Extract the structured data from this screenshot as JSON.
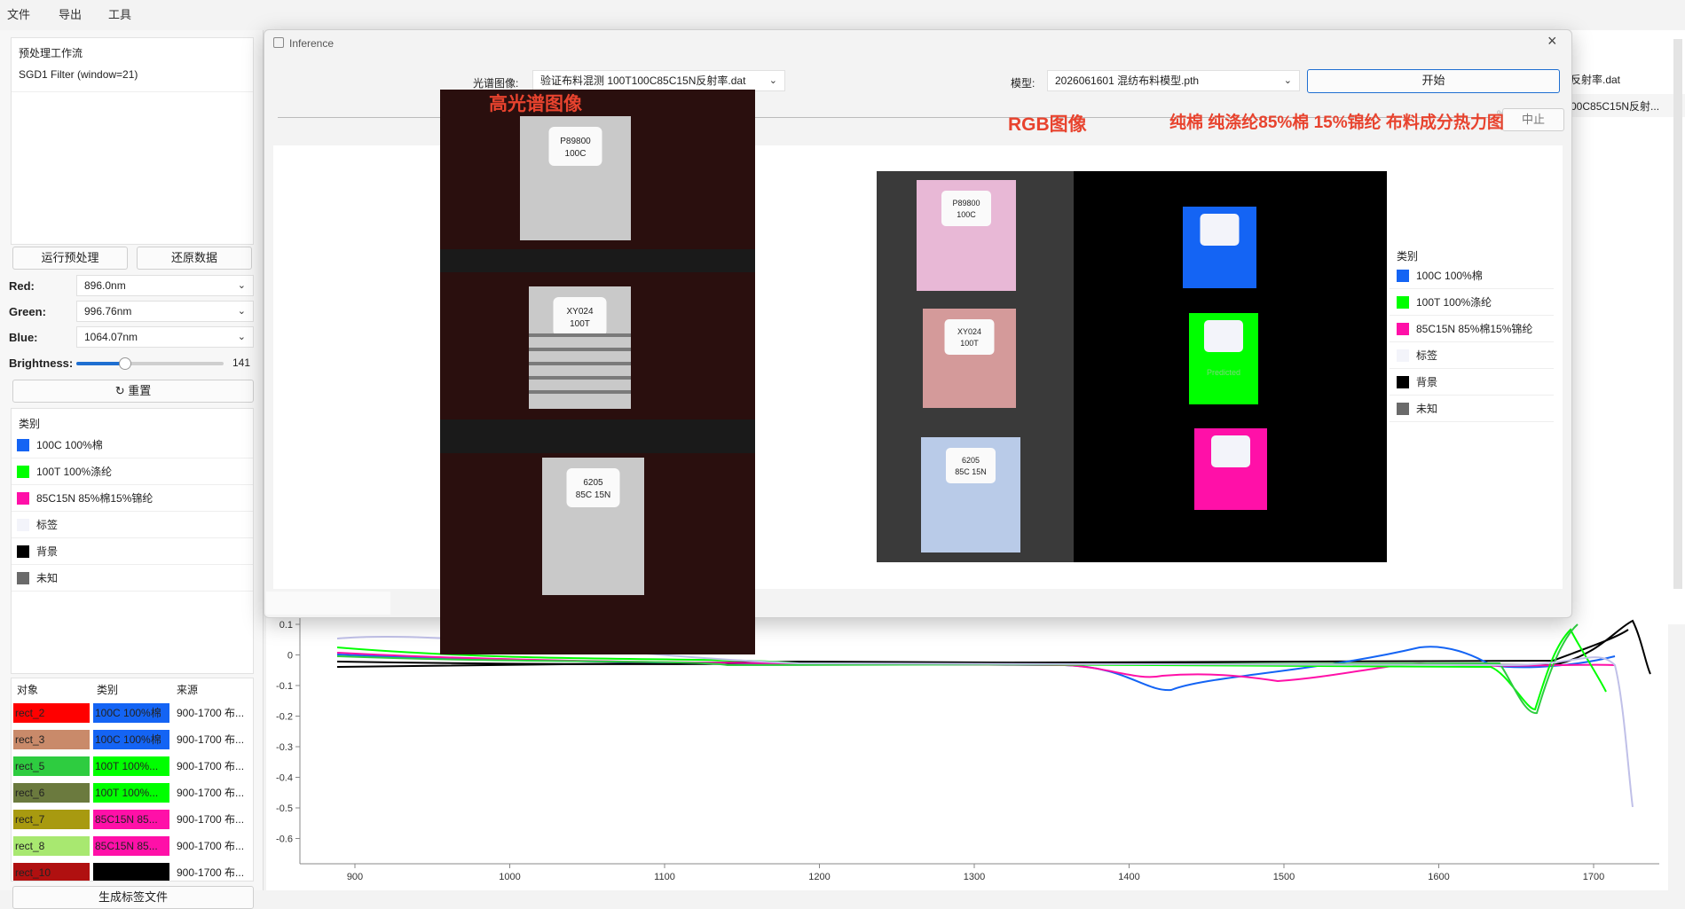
{
  "menu": [
    "文件",
    "导出",
    "工具"
  ],
  "left": {
    "workflow_title": "预处理工作流",
    "workflow_item": "SGD1 Filter (window=21)",
    "run_btn": "运行预处理",
    "restore_btn": "还原数据",
    "red_label": "Red:",
    "red_value": "896.0nm",
    "green_label": "Green:",
    "green_value": "996.76nm",
    "blue_label": "Blue:",
    "blue_value": "1064.07nm",
    "brightness_label": "Brightness:",
    "brightness_value": "141",
    "brightness_level": 0.33,
    "reset_btn": "重置",
    "class_header": "类别",
    "classes": [
      {
        "name": "100C 100%棉",
        "color": "#1464f4"
      },
      {
        "name": "100T 100%涤纶",
        "color": "#00ff00"
      },
      {
        "name": "85C15N 85%棉15%锦纶",
        "color": "#ff10a8"
      },
      {
        "name": "标签",
        "color": "#f3f4fa"
      },
      {
        "name": "背景",
        "color": "#000000"
      },
      {
        "name": "未知",
        "color": "#6a6a6a"
      }
    ],
    "table_headers": [
      "对象",
      "类别",
      "来源"
    ],
    "table_rows": [
      {
        "obj": "rect_2",
        "obj_color": "#ff0000",
        "cls": "100C 100%棉",
        "cls_color": "#1464f4",
        "src": "900-1700 布..."
      },
      {
        "obj": "rect_3",
        "obj_color": "#c98a6a",
        "cls": "100C 100%棉",
        "cls_color": "#1464f4",
        "src": "900-1700 布..."
      },
      {
        "obj": "rect_5",
        "obj_color": "#2ecc40",
        "cls": "100T 100%...",
        "cls_color": "#00ff00",
        "src": "900-1700 布..."
      },
      {
        "obj": "rect_6",
        "obj_color": "#6b7a3e",
        "cls": "100T 100%...",
        "cls_color": "#00ff00",
        "src": "900-1700 布..."
      },
      {
        "obj": "rect_7",
        "obj_color": "#a89a10",
        "cls": "85C15N 85...",
        "cls_color": "#ff10a8",
        "src": "900-1700 布..."
      },
      {
        "obj": "rect_8",
        "obj_color": "#a8e870",
        "cls": "85C15N 85...",
        "cls_color": "#ff10a8",
        "src": "900-1700 布..."
      },
      {
        "obj": "rect_10",
        "obj_color": "#b01010",
        "cls": "",
        "cls_color": "#000000",
        "src": "900-1700 布..."
      }
    ],
    "gen_btn": "生成标签文件"
  },
  "right_bg": {
    "item1": "反射率.dat",
    "item2": "00C85C15N反射..."
  },
  "dialog": {
    "title": "Inference",
    "spectral_label": "光谱图像:",
    "spectral_value": "验证布料混测 100T100C85C15N反射率.dat",
    "model_label": "模型:",
    "model_value": "2026061601 混纺布料模型.pth",
    "start_btn": "开始",
    "stop_btn": "中止",
    "progress_suffix": "%",
    "overlay_hsi": "高光谱图像",
    "overlay_rgb": "RGB图像",
    "overlay_heat": "纯棉 纯涤纶85%棉 15%锦纶 布料成分热力图",
    "legend_header": "类别",
    "legend": [
      {
        "name": "100C 100%棉",
        "color": "#1464f4"
      },
      {
        "name": "100T 100%涤纶",
        "color": "#00ff00"
      },
      {
        "name": "85C15N 85%棉15%锦纶",
        "color": "#ff10a8"
      },
      {
        "name": "标签",
        "color": "#f3f4fa"
      },
      {
        "name": "背景",
        "color": "#000000"
      },
      {
        "name": "未知",
        "color": "#6a6a6a"
      }
    ],
    "tags": [
      {
        "l1": "P89800",
        "l2": "100C"
      },
      {
        "l1": "XY024",
        "l2": "100T"
      },
      {
        "l1": "6205",
        "l2": "85C 15N"
      }
    ],
    "heat_label": "Predicted"
  },
  "plot": {
    "y_ticks": [
      "0.1",
      "0",
      "-0.1",
      "-0.2",
      "-0.3",
      "-0.4",
      "-0.5",
      "-0.6"
    ],
    "x_ticks": [
      "900",
      "1000",
      "1100",
      "1200",
      "1300",
      "1400",
      "1500",
      "1600",
      "1700"
    ]
  }
}
